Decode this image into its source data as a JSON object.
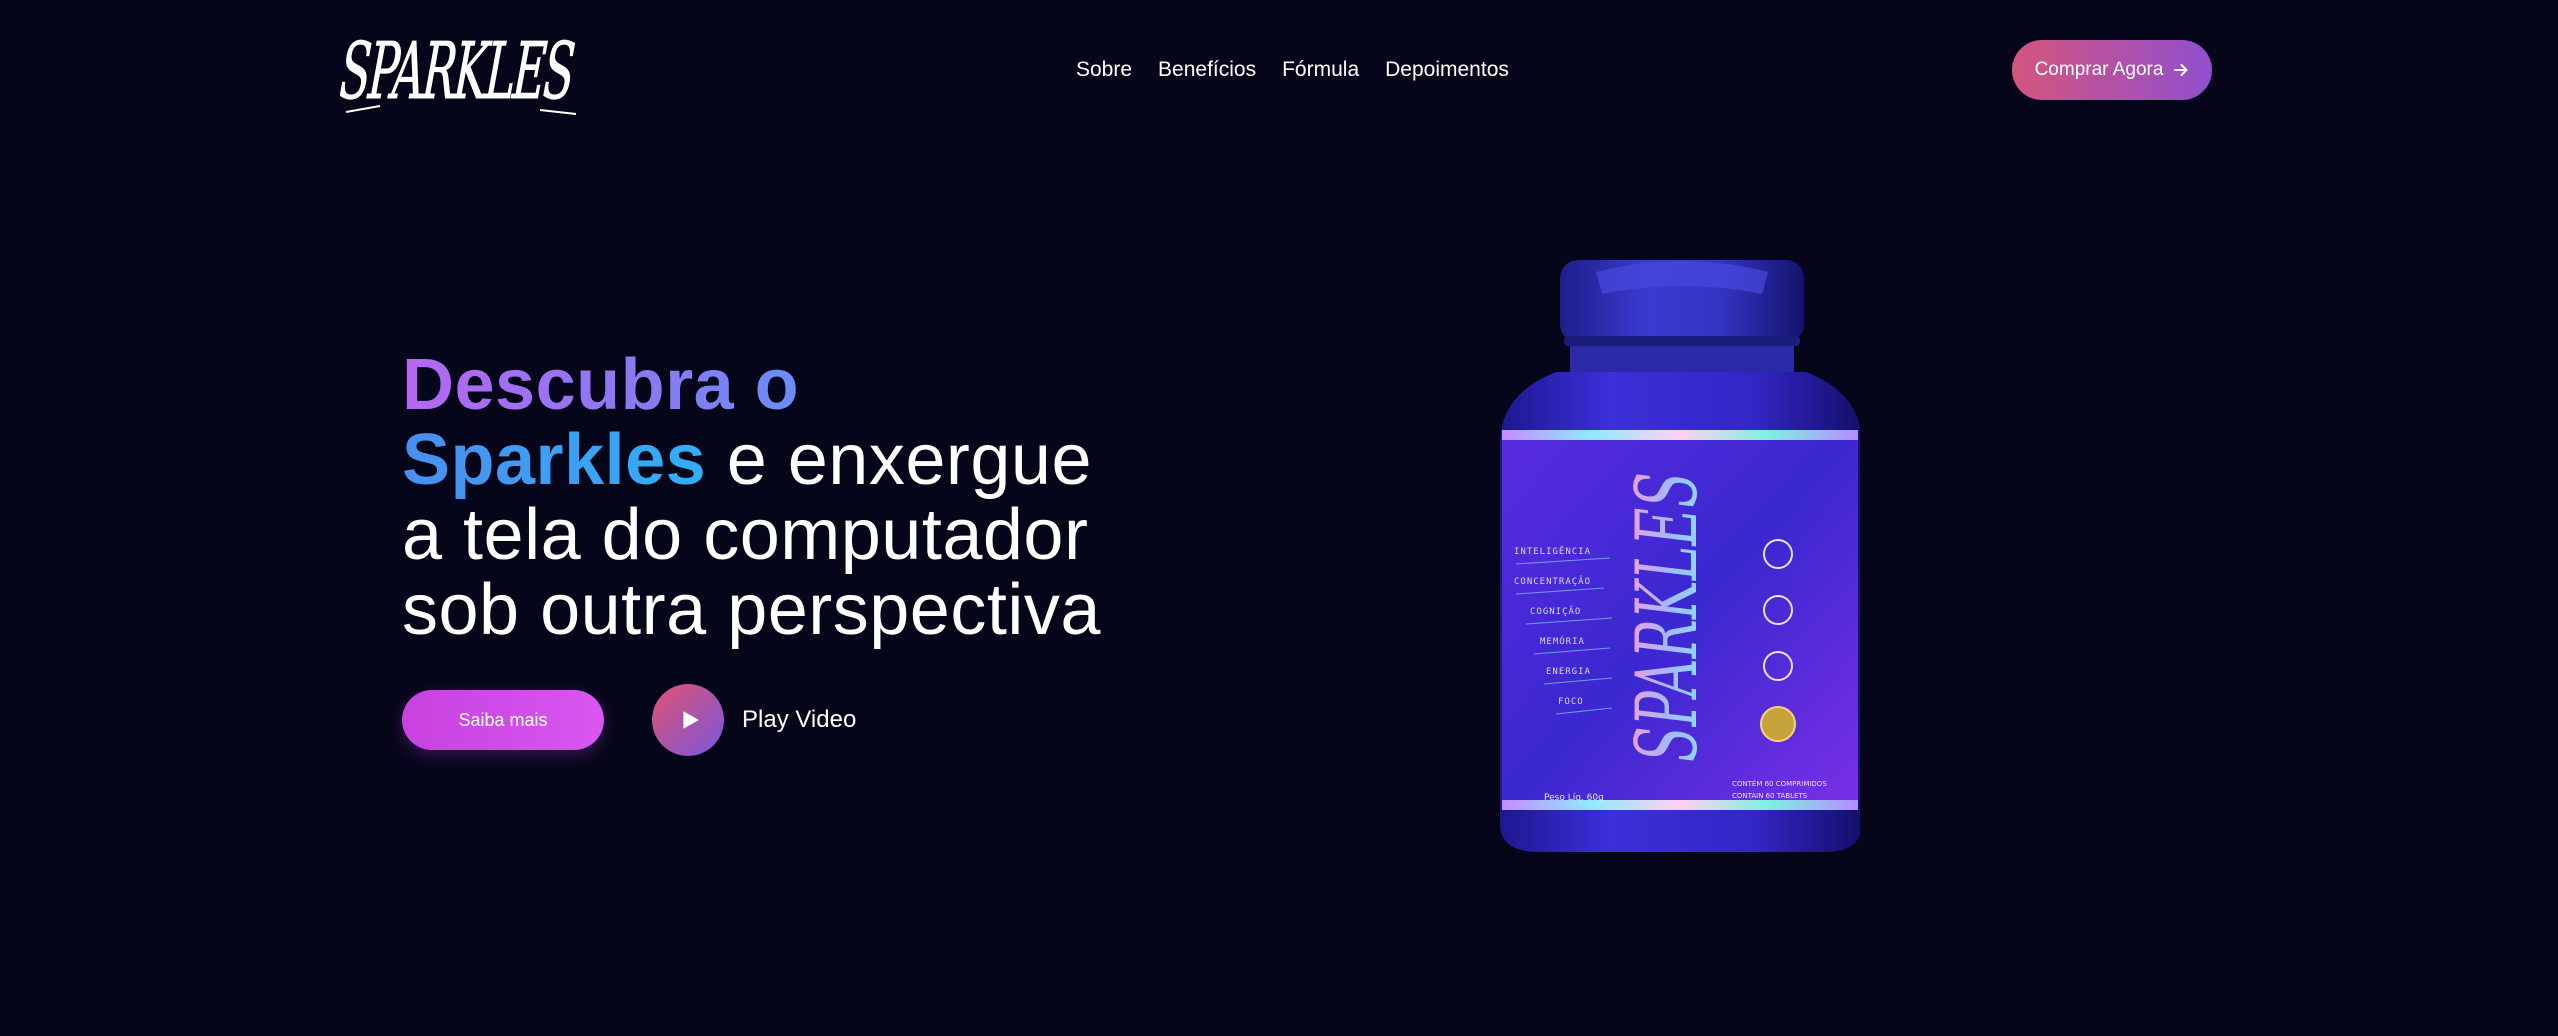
{
  "header": {
    "logo_text": "SPARKLES",
    "nav": [
      "Sobre",
      "Benefícios",
      "Fórmula",
      "Depoimentos"
    ],
    "buy_button": "Comprar Agora"
  },
  "hero": {
    "headline_part1": "Descubra o",
    "headline_brand": "Sparkles",
    "headline_part2": " e enxergue",
    "headline_line3": "a tela do computador",
    "headline_line4": "sob outra perspectiva",
    "cta_more": "Saiba mais",
    "cta_play": "Play Video"
  },
  "product": {
    "brand": "SPARKLES",
    "benefits": [
      "INTELIGÊNCIA",
      "CONCENTRAÇÃO",
      "COGNIÇÃO",
      "MEMÓRIA",
      "ENERGIA",
      "FOCO"
    ],
    "weight": "Peso Líq. 60g",
    "contents_pt": "CONTÉM 60 COMPRIMIDOS",
    "contents_en": "CONTAIN 60 TABLETS"
  },
  "colors": {
    "background": "#06061a",
    "buy_gradient_start": "#d5557d",
    "buy_gradient_end": "#8f4fcf",
    "cta_more": "#d04ae8",
    "headline_purple": "#b566f3",
    "headline_blue": "#2fb0f7"
  },
  "icons": {
    "buy_arrow": "arrow-right-icon",
    "play": "play-icon"
  }
}
